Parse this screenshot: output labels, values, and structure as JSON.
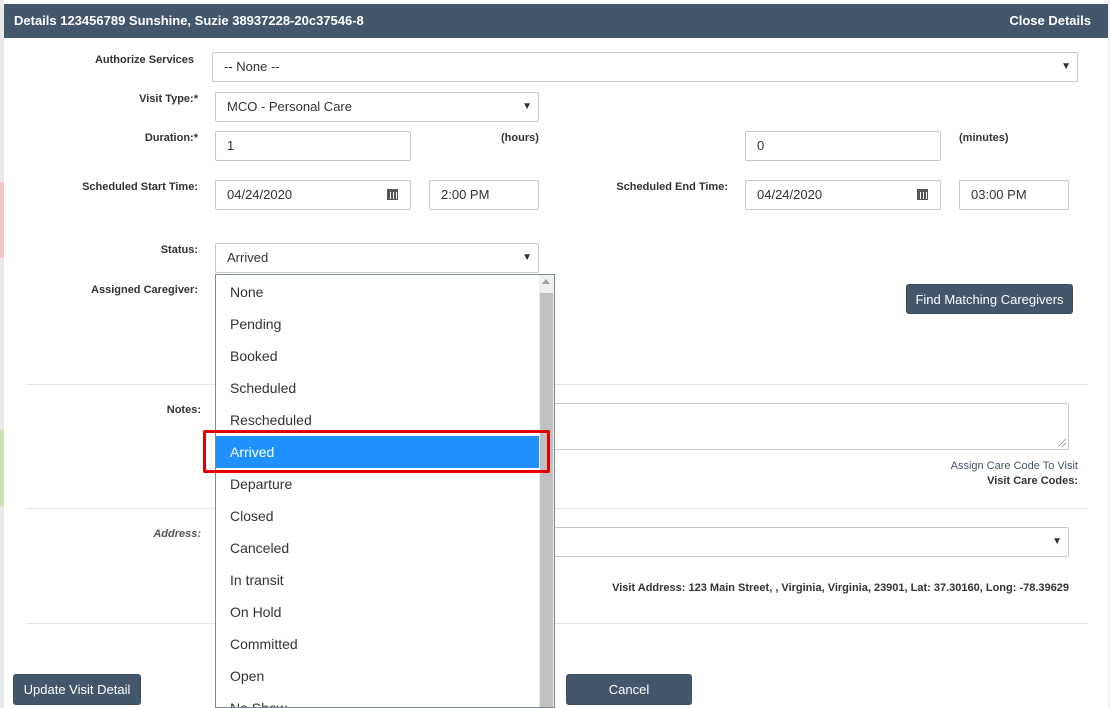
{
  "header": {
    "title": "Details 123456789 Sunshine, Suzie 38937228-20c37546-8",
    "close_label": "Close Details"
  },
  "form": {
    "authorize_services": {
      "label": "Authorize Services",
      "value": "-- None --"
    },
    "visit_type": {
      "label": "Visit Type:*",
      "value": "MCO - Personal Care"
    },
    "duration": {
      "label": "Duration:*",
      "hours_value": "1",
      "hours_unit": "(hours)",
      "minutes_value": "0",
      "minutes_unit": "(minutes)"
    },
    "scheduled_start": {
      "label": "Scheduled Start Time:",
      "date": "04/24/2020",
      "time": "2:00 PM"
    },
    "scheduled_end": {
      "label": "Scheduled End Time:",
      "date": "04/24/2020",
      "time": "03:00 PM"
    },
    "status": {
      "label": "Status:",
      "value": "Arrived",
      "options": [
        "None",
        "Pending",
        "Booked",
        "Scheduled",
        "Rescheduled",
        "Arrived",
        "Departure",
        "Closed",
        "Canceled",
        "In transit",
        "On Hold",
        "Committed",
        "Open",
        "No Show"
      ],
      "selected_index": 5
    },
    "assigned_caregiver": {
      "label": "Assigned Caregiver:"
    },
    "find_caregivers_label": "Find Matching Caregivers",
    "notes": {
      "label": "Notes:"
    },
    "assign_care_code_label": "Assign Care Code To Visit",
    "visit_care_codes_label": "Visit Care Codes:",
    "address": {
      "label": "Address:"
    },
    "visit_address": "Visit Address: 123 Main Street, , Virginia, Virginia, 23901, Lat: 37.30160, Long: -78.39629"
  },
  "footer": {
    "update_label": "Update Visit Detail",
    "cancel_label": "Cancel"
  },
  "colors": {
    "header_bg": "#43576b",
    "selected_option_bg": "#1e90ff",
    "highlight_border": "#e00000"
  }
}
